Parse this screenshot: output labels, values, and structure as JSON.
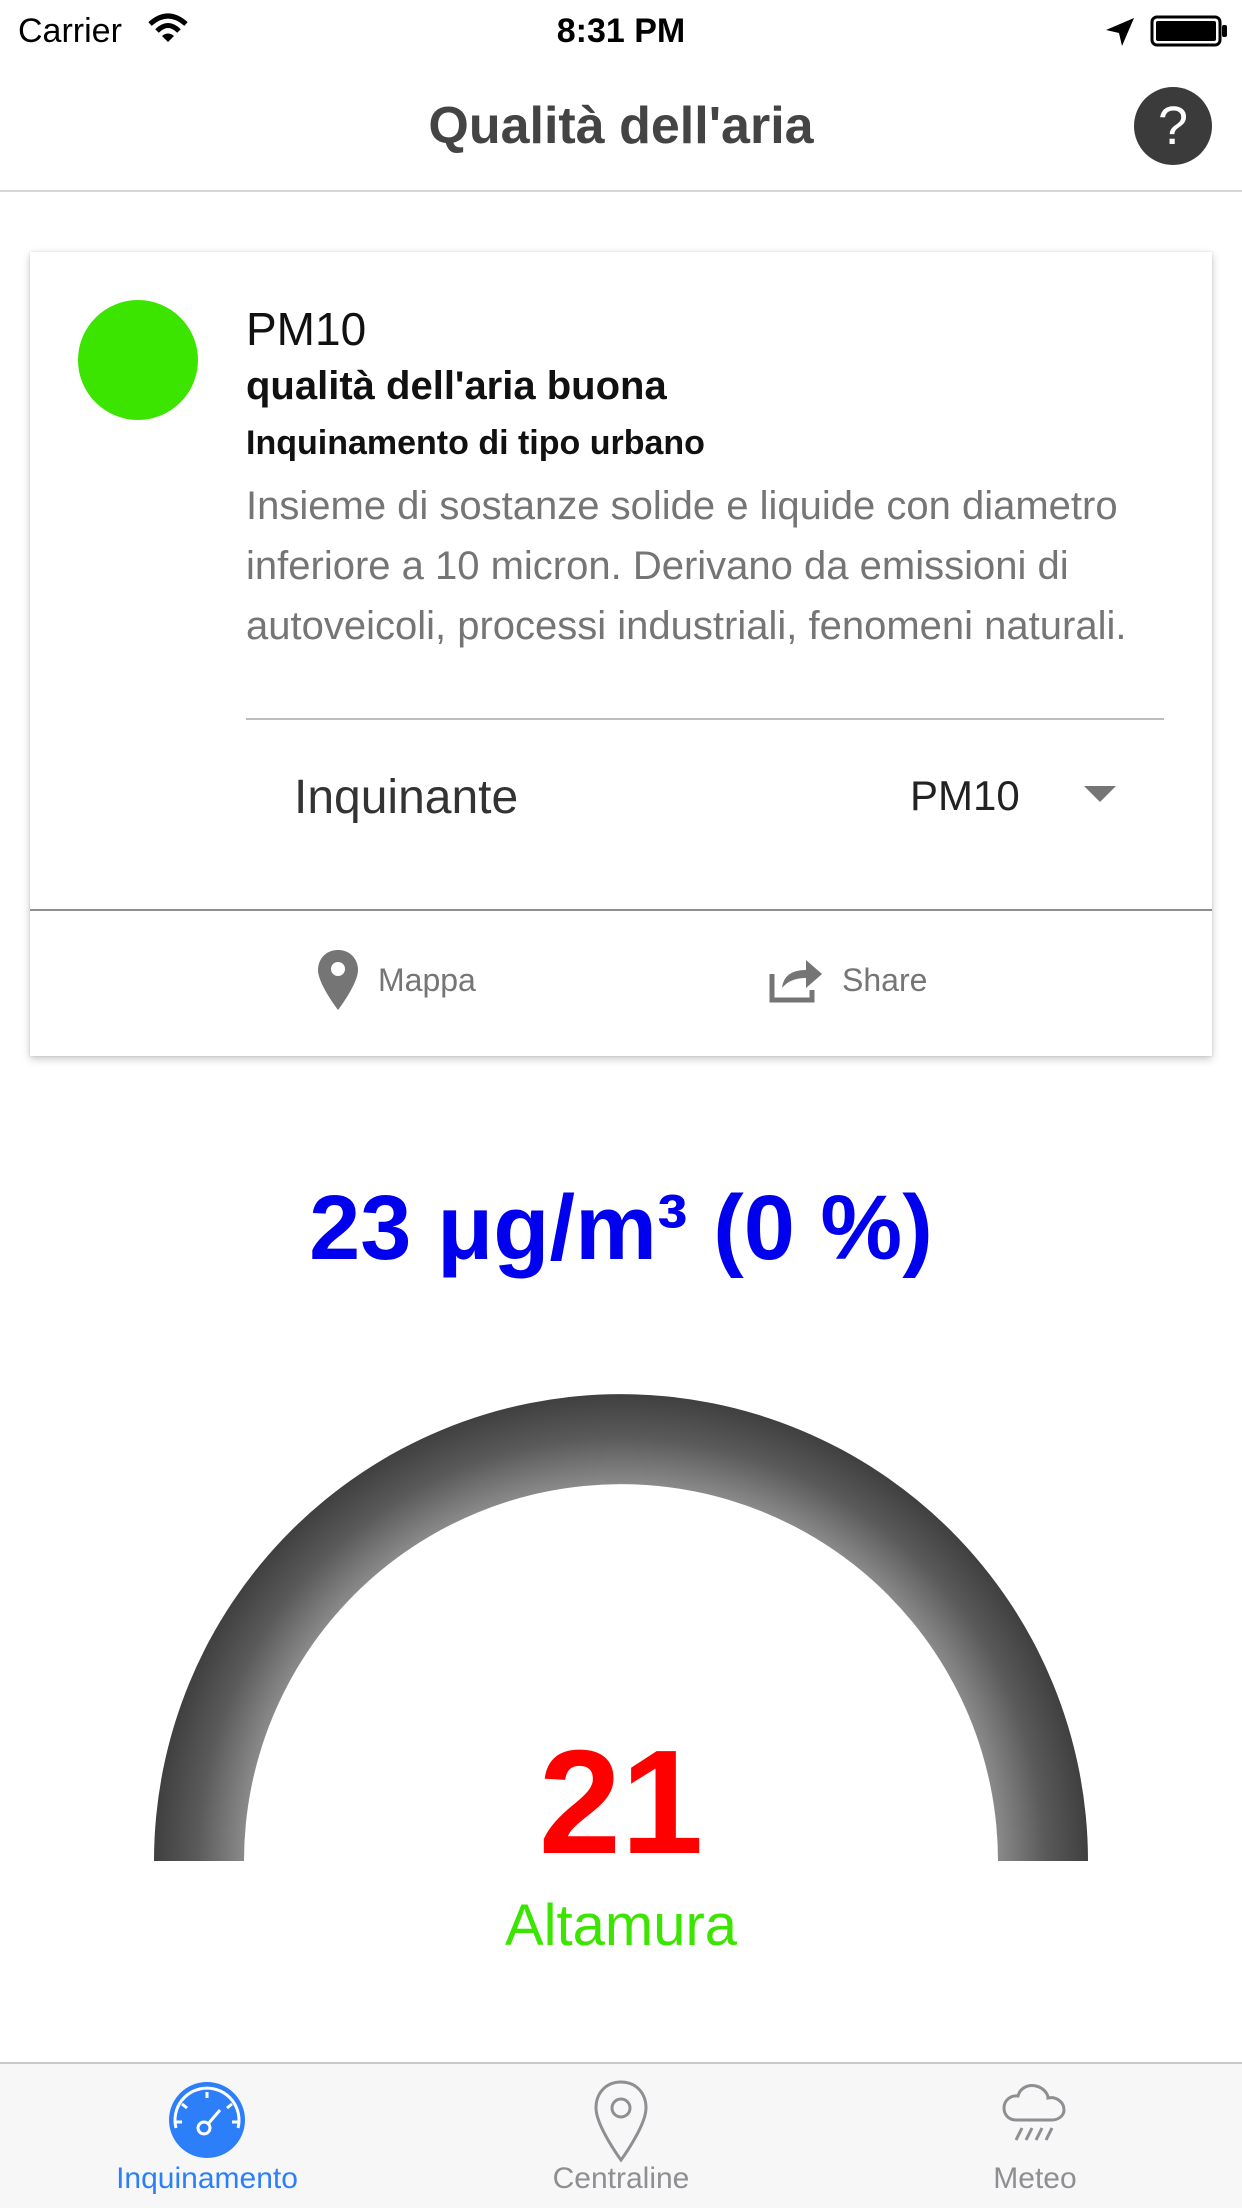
{
  "status_bar": {
    "carrier": "Carrier",
    "time": "8:31 PM",
    "icons": [
      "wifi-icon",
      "location-arrow-icon",
      "battery-icon"
    ]
  },
  "nav": {
    "title": "Qualità dell'aria",
    "help_label": "?"
  },
  "card": {
    "status_color": "#3ce500",
    "pollutant": "PM10",
    "quality": "qualità dell'aria buona",
    "pollution_type": "Inquinamento di tipo urbano",
    "description": "Insieme di sostanze solide e liquide con diametro inferiore a 10 micron. Derivano da emissioni di autoveicoli, processi industriali, fenomeni naturali.",
    "select": {
      "label": "Inquinante",
      "value": "PM10"
    },
    "actions": {
      "map_label": "Mappa",
      "share_label": "Share"
    }
  },
  "reading": {
    "headline": "23 μg/m³ (0 %)",
    "headline_color": "#0000ee",
    "gauge_value": "21",
    "gauge_value_color": "#ff0000",
    "location": "Altamura",
    "location_color": "#3ce500"
  },
  "tabs": [
    {
      "label": "Inquinamento",
      "icon": "speedometer-icon",
      "active": true
    },
    {
      "label": "Centraline",
      "icon": "map-pin-icon",
      "active": false
    },
    {
      "label": "Meteo",
      "icon": "rain-cloud-icon",
      "active": false
    }
  ],
  "colors": {
    "accent": "#2d7ff9",
    "inactive_tab": "#8e8e93"
  }
}
